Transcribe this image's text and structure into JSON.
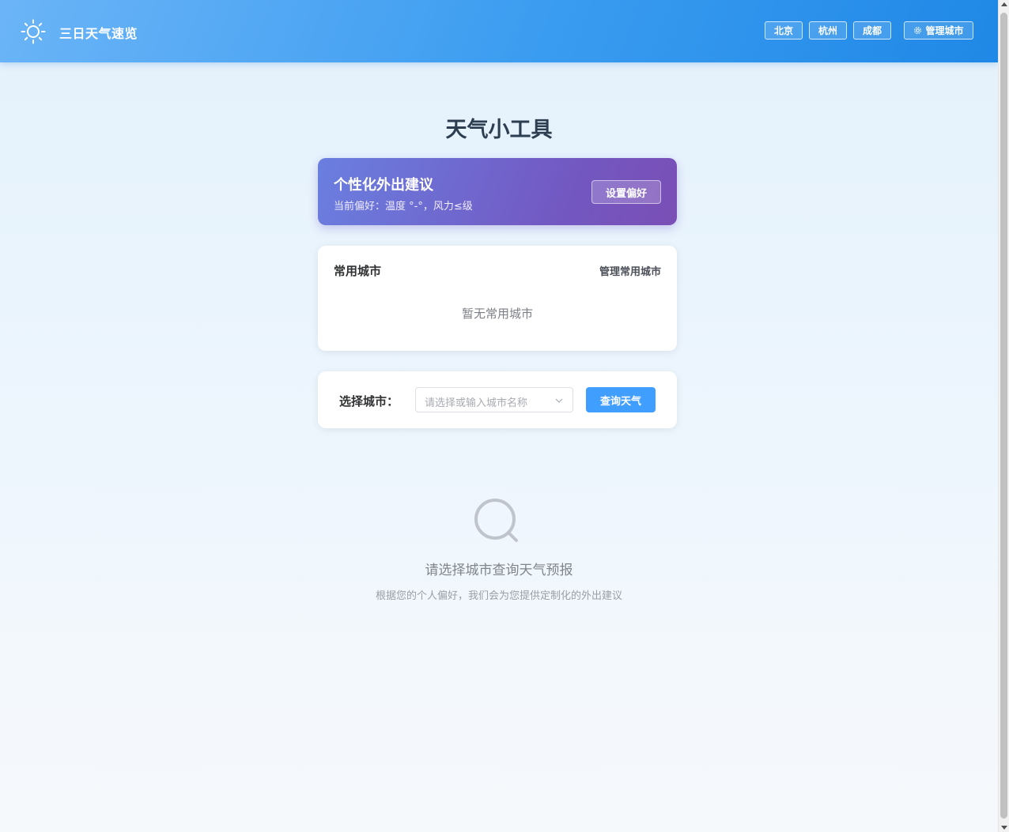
{
  "header": {
    "logo_icon": "sun-icon",
    "app_title": "三日天气速览",
    "quick_cities": [
      "北京",
      "杭州",
      "成都"
    ],
    "manage_label": "管理城市",
    "manage_icon": "gear-icon"
  },
  "page_title": "天气小工具",
  "advice_card": {
    "title": "个性化外出建议",
    "subtitle": "当前偏好：温度 °-°，风力≤级",
    "button_label": "设置偏好"
  },
  "favorites": {
    "title": "常用城市",
    "manage_link": "管理常用城市",
    "empty_text": "暂无常用城市"
  },
  "search": {
    "label": "选择城市：",
    "placeholder": "请选择或输入城市名称",
    "button_label": "查询天气"
  },
  "empty_state": {
    "icon": "search-icon",
    "title": "请选择城市查询天气预报",
    "subtitle": "根据您的个人偏好，我们会为您提供定制化的外出建议"
  },
  "colors": {
    "header_start": "#6bb4f7",
    "header_end": "#1f88e6",
    "advice_start": "#6a7fe0",
    "advice_end": "#7a4fb5",
    "primary": "#409eff"
  }
}
